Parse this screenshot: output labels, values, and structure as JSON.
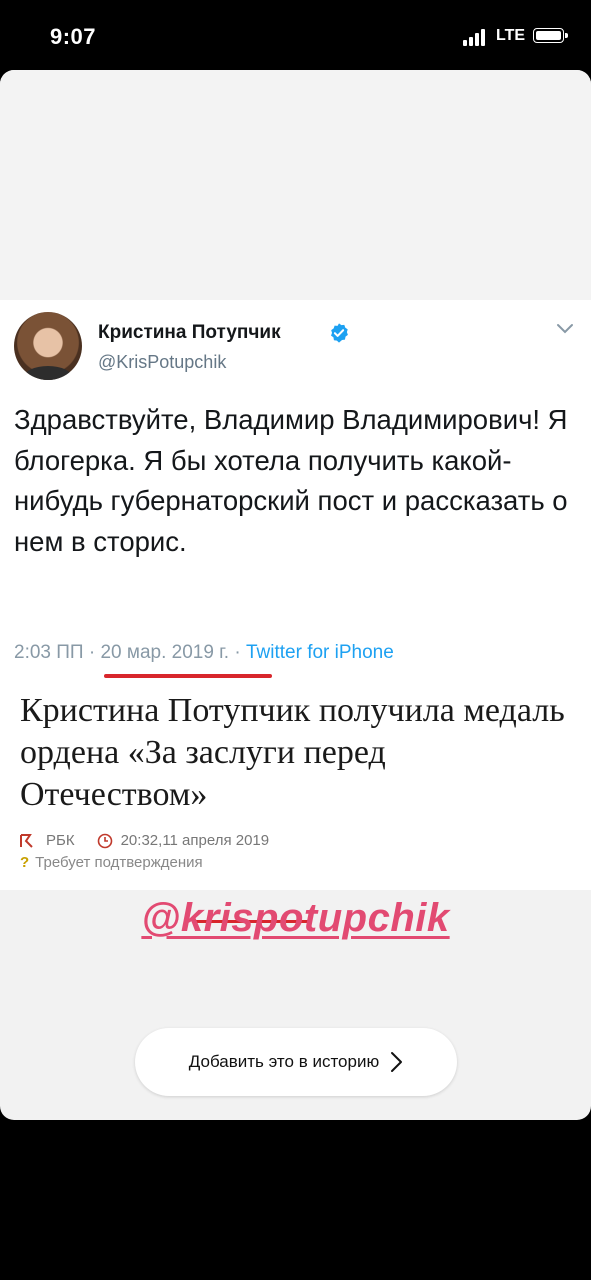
{
  "status_bar": {
    "time": "9:07",
    "network": "LTE"
  },
  "tweet": {
    "author_name": "Кристина Потупчик",
    "handle": "@KrisPotupchik",
    "text": "Здравствуйте, Владимир Владимирович! Я блогерка. Я бы хотела получить какой-нибудь губернаторский пост и рассказать о нем в сторис.",
    "time": "2:03 ПП",
    "separator": " · ",
    "date": "20 мар. 2019 г.",
    "source": "Twitter for iPhone",
    "verified_color": "#1da1f2"
  },
  "news": {
    "headline": "Кристина Потупчик получила медаль ордена «За заслуги перед Отечеством»",
    "outlet": "РБК",
    "time": "20:32, ",
    "date": "11 апреля 2019",
    "verification": "Требует подтверждения"
  },
  "mention": "@krispotupchik",
  "add_story_button": {
    "label": "Добавить это в историю"
  },
  "colors": {
    "underline": "#d8262c",
    "mention": "#e24a72"
  }
}
